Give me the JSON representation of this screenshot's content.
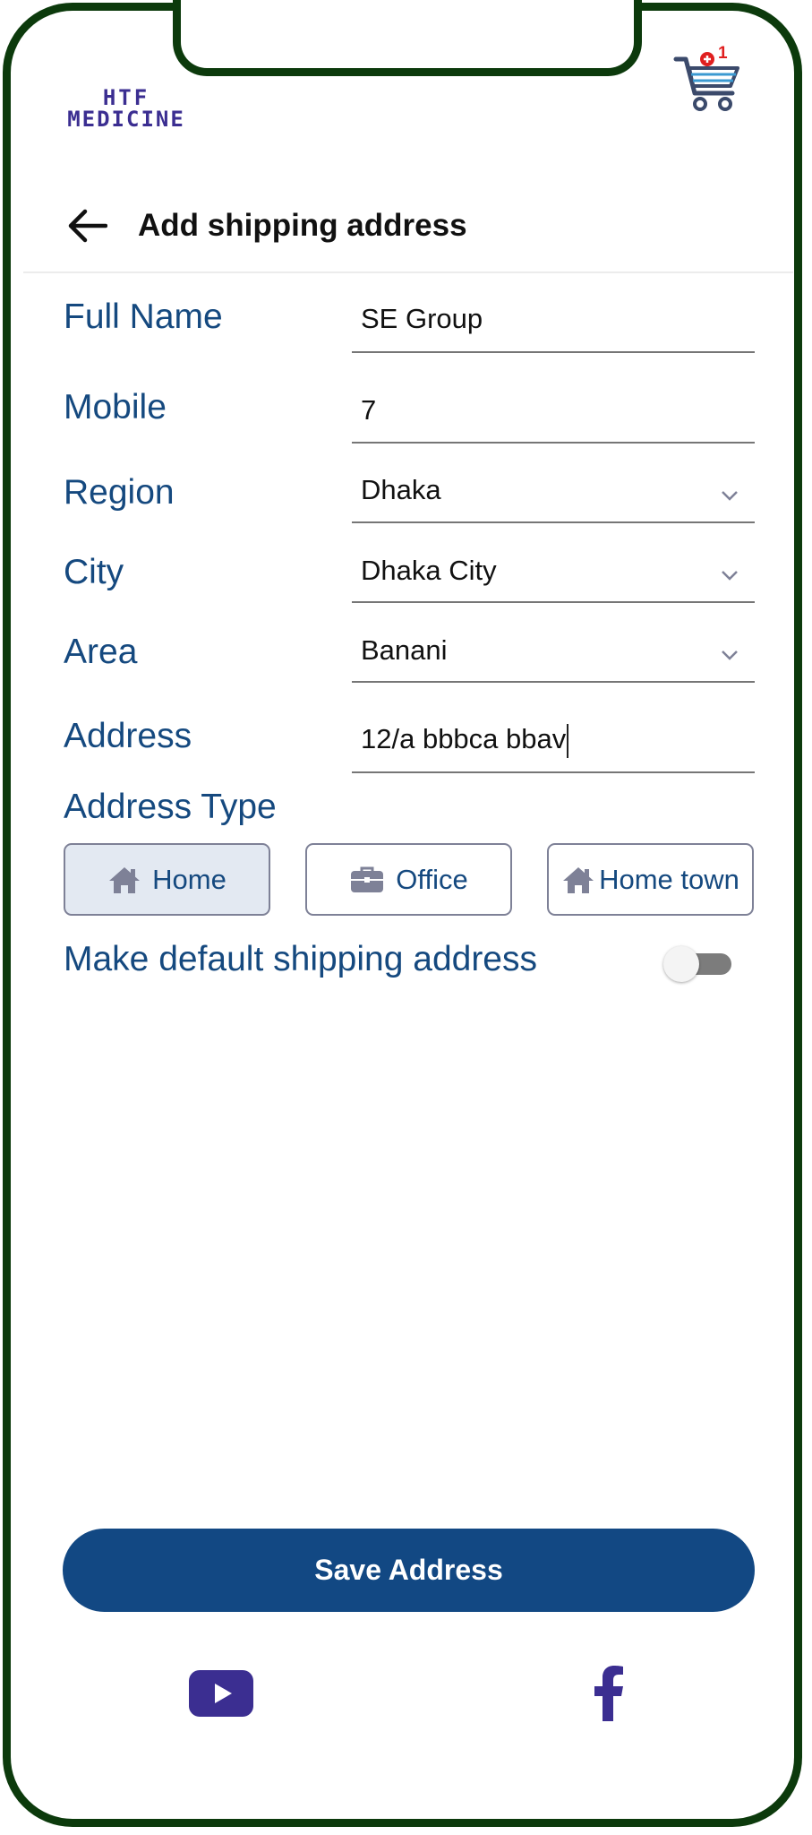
{
  "header": {
    "logo_line1": "HTF",
    "logo_line2": "MEDICINE",
    "cart_badge": "+1"
  },
  "page": {
    "title": "Add shipping address"
  },
  "form": {
    "full_name_label": "Full Name",
    "full_name_value": "SE Group",
    "mobile_label": "Mobile",
    "mobile_value": "7",
    "region_label": "Region",
    "region_value": "Dhaka",
    "city_label": "City",
    "city_value": "Dhaka City",
    "area_label": "Area",
    "area_value": "Banani",
    "address_label": "Address",
    "address_value": "12/a bbbca bbav",
    "address_type_label": "Address Type",
    "address_types": [
      {
        "label": "Home",
        "icon": "home-icon",
        "selected": true
      },
      {
        "label": "Office",
        "icon": "briefcase-icon",
        "selected": false
      },
      {
        "label": "Home town",
        "icon": "home-icon",
        "selected": false
      }
    ],
    "default_label": "Make default shipping address",
    "default_on": false
  },
  "actions": {
    "save_label": "Save Address"
  },
  "footer": {
    "icons": [
      "youtube-icon",
      "facebook-icon"
    ]
  },
  "colors": {
    "frame": "#0c3a0c",
    "label": "#15497f",
    "primary_button": "#124883",
    "logo": "#3b2e91",
    "badge": "#e02020"
  }
}
